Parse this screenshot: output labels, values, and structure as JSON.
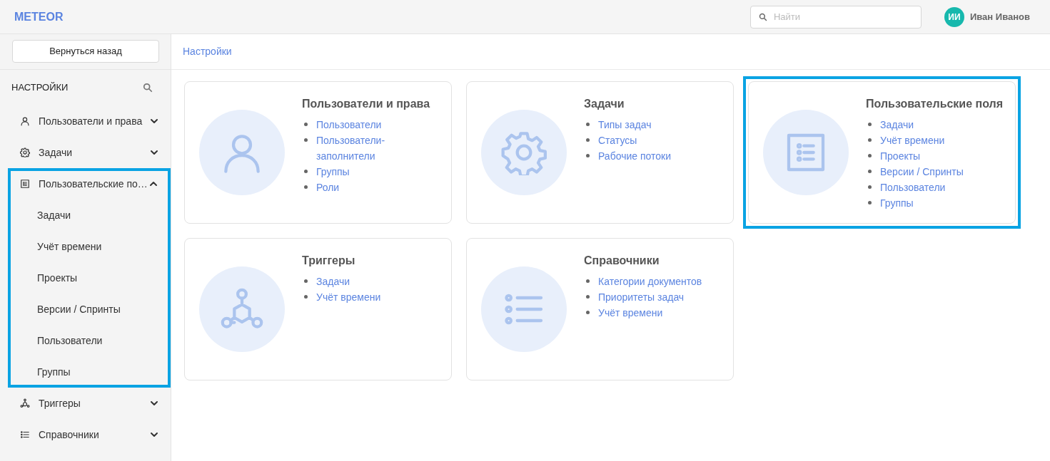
{
  "header": {
    "logo": "METEOR",
    "search": {
      "placeholder": "Найти"
    },
    "user": {
      "initials": "ИИ",
      "name": "Иван Иванов"
    }
  },
  "sidebar": {
    "back_button": "Вернуться назад",
    "title": "НАСТРОЙКИ",
    "items": [
      {
        "label": "Пользователи и права",
        "kind": "user",
        "expanded": false,
        "highlighted": false
      },
      {
        "label": "Задачи",
        "kind": "gear",
        "expanded": false,
        "highlighted": false
      },
      {
        "label": "Пользовательские по…",
        "kind": "form",
        "expanded": true,
        "highlighted": true,
        "children": [
          {
            "label": "Задачи"
          },
          {
            "label": "Учёт времени"
          },
          {
            "label": "Проекты"
          },
          {
            "label": "Версии / Спринты"
          },
          {
            "label": "Пользователи"
          },
          {
            "label": "Группы"
          }
        ]
      },
      {
        "label": "Триггеры",
        "kind": "nodes",
        "expanded": false,
        "highlighted": false
      },
      {
        "label": "Справочники",
        "kind": "list",
        "expanded": false,
        "highlighted": false
      }
    ]
  },
  "breadcrumb": "Настройки",
  "cards": [
    {
      "title": "Пользователи и права",
      "kind": "user",
      "highlighted": false,
      "links": [
        "Пользователи",
        "Пользователи-заполнители",
        "Группы",
        "Роли"
      ]
    },
    {
      "title": "Задачи",
      "kind": "gear",
      "highlighted": false,
      "links": [
        "Типы задач",
        "Статусы",
        "Рабочие потоки"
      ]
    },
    {
      "title": "Пользовательские поля",
      "kind": "form",
      "highlighted": true,
      "links": [
        "Задачи",
        "Учёт времени",
        "Проекты",
        "Версии / Спринты",
        "Пользователи",
        "Группы"
      ]
    },
    {
      "title": "Триггеры",
      "kind": "nodes",
      "highlighted": false,
      "links": [
        "Задачи",
        "Учёт времени"
      ]
    },
    {
      "title": "Справочники",
      "kind": "list",
      "highlighted": false,
      "links": [
        "Категории документов",
        "Приоритеты задач",
        "Учёт времени"
      ]
    }
  ]
}
